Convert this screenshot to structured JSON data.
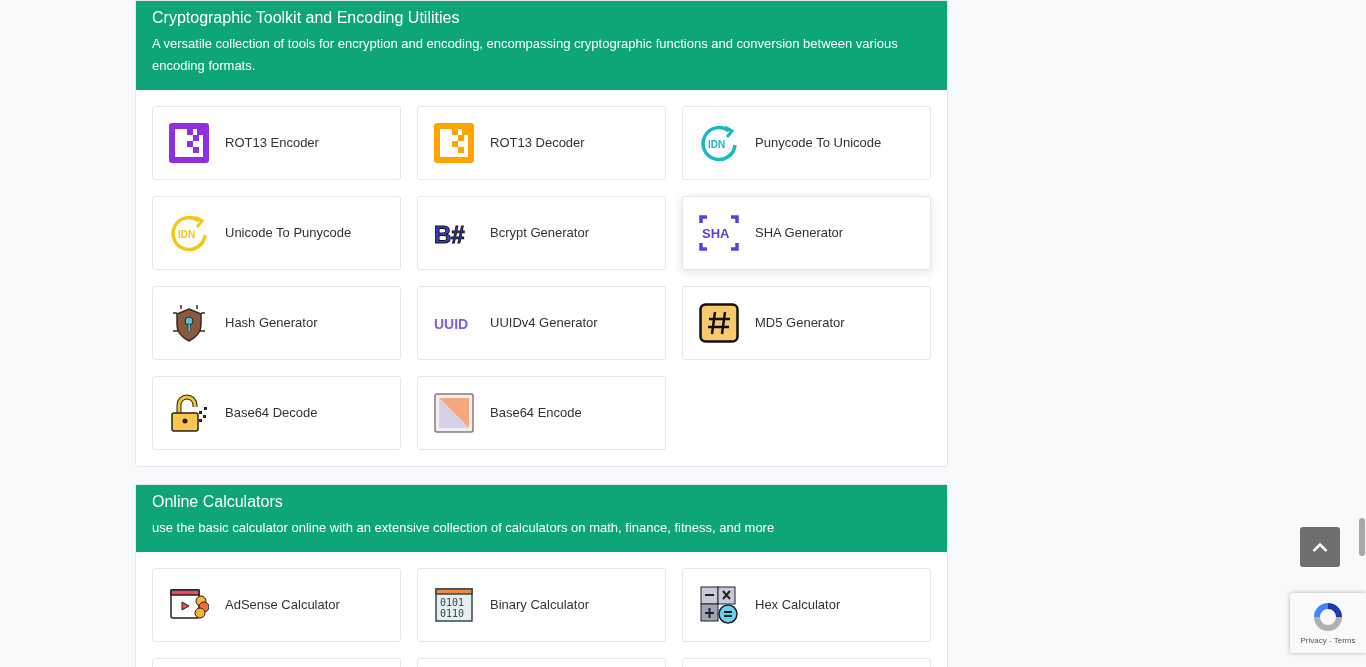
{
  "sections": [
    {
      "title": "Cryptographic Toolkit and Encoding Utilities",
      "description": "A versatile collection of tools for encryption and encoding, encompassing cryptographic functions and conversion between various encoding formats.",
      "tools": [
        {
          "kind": "tool",
          "label": "ROT13 Encoder",
          "hovered": false
        },
        {
          "kind": "tool",
          "label": "ROT13 Decoder",
          "hovered": false
        },
        {
          "kind": "tool",
          "label": "Punycode To Unicode",
          "hovered": false,
          "icon_text": "IDN"
        },
        {
          "kind": "tool",
          "label": "Unicode To Punycode",
          "hovered": false,
          "icon_text": "IDN"
        },
        {
          "kind": "tool",
          "label": "Bcrypt Generator",
          "hovered": false,
          "icon_text": "B#"
        },
        {
          "kind": "tool",
          "label": "SHA Generator",
          "hovered": true,
          "icon_text": "SHA"
        },
        {
          "kind": "tool",
          "label": "Hash Generator",
          "hovered": false
        },
        {
          "kind": "tool",
          "label": "UUIDv4 Generator",
          "hovered": false,
          "icon_text": "UUID"
        },
        {
          "kind": "tool",
          "label": "MD5 Generator",
          "hovered": false
        },
        {
          "kind": "tool",
          "label": "Base64 Decode",
          "hovered": false
        },
        {
          "kind": "tool",
          "label": "Base64 Encode",
          "hovered": false
        }
      ]
    },
    {
      "title": "Online Calculators",
      "description": "use the basic calculator online with an extensive collection of calculators on math, finance, fitness, and more",
      "tools": [
        {
          "kind": "tool",
          "label": "AdSense Calculator",
          "hovered": false
        },
        {
          "kind": "tool",
          "label": "Binary Calculator",
          "hovered": false,
          "icon_lines": [
            "0101",
            "0110"
          ]
        },
        {
          "kind": "tool",
          "label": "Hex Calculator",
          "hovered": false
        },
        {
          "kind": "cut-off"
        },
        {
          "kind": "cut-off"
        },
        {
          "kind": "cut-off"
        }
      ]
    }
  ],
  "recaptcha": {
    "links": "Privacy - Terms"
  }
}
